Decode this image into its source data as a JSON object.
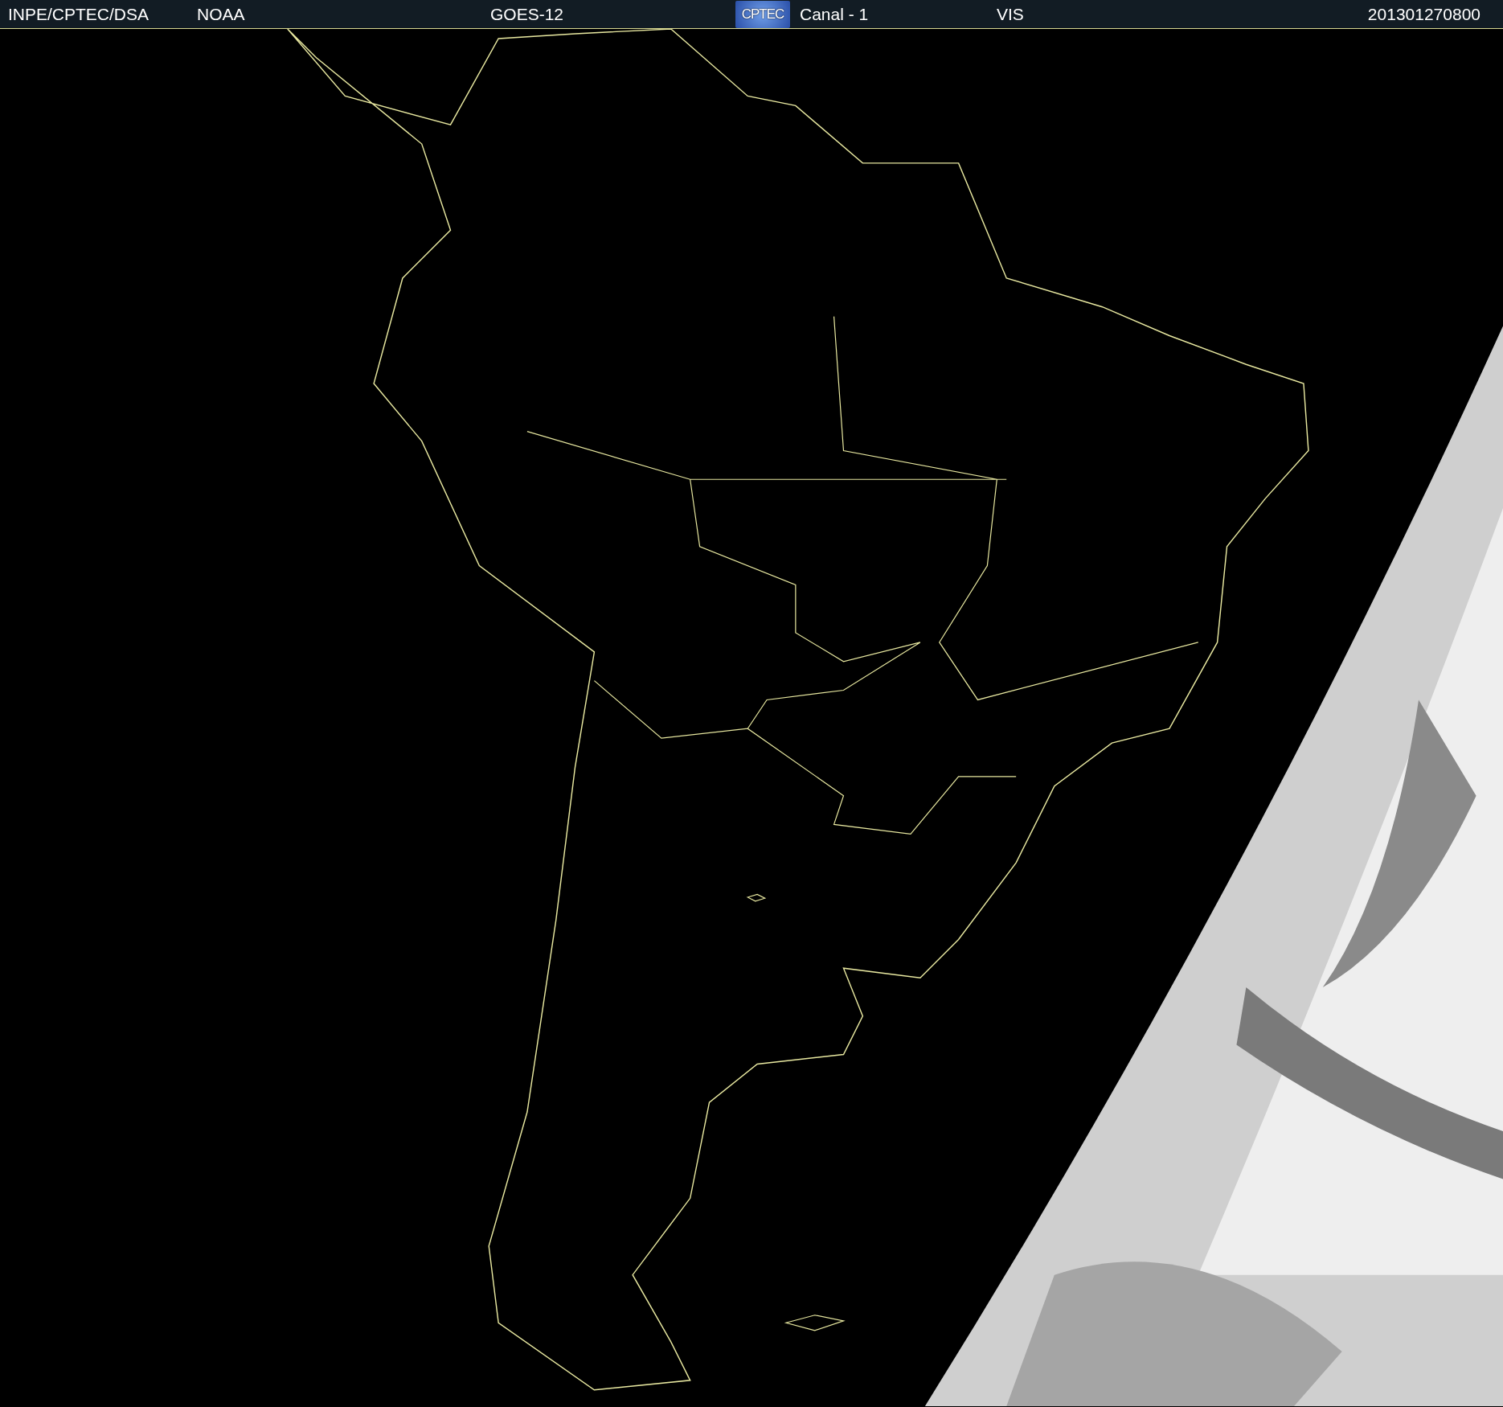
{
  "header": {
    "items": [
      {
        "kind": "text",
        "text": "INPE/CPTEC/DSA"
      },
      {
        "kind": "text",
        "text": "NOAA"
      },
      {
        "kind": "text",
        "text": "GOES-12"
      },
      {
        "kind": "logo",
        "text": "CPTEC"
      },
      {
        "kind": "text",
        "text": "Canal - 1"
      },
      {
        "kind": "text",
        "text": "VIS"
      },
      {
        "kind": "text",
        "text": "201301270800"
      }
    ]
  }
}
